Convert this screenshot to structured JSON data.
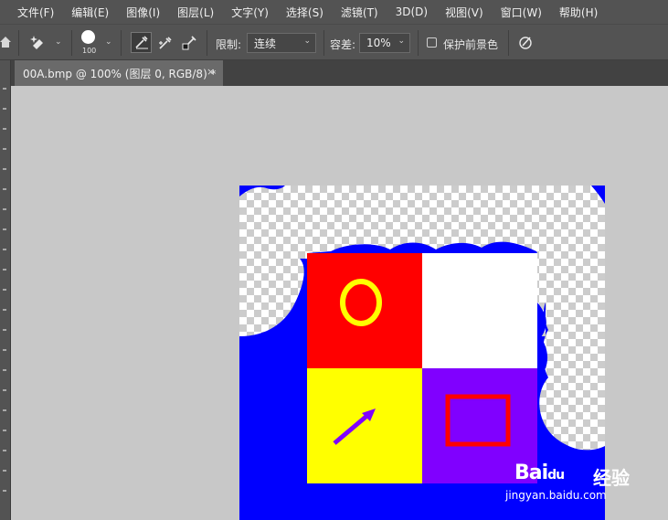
{
  "menubar": {
    "items": [
      "文件(F)",
      "编辑(E)",
      "图像(I)",
      "图层(L)",
      "文字(Y)",
      "选择(S)",
      "滤镜(T)",
      "3D(D)",
      "视图(V)",
      "窗口(W)",
      "帮助(H)"
    ]
  },
  "options": {
    "brush_size": "100",
    "limit_label": "限制:",
    "limit_value": "连续",
    "tolerance_label": "容差:",
    "tolerance_value": "10%",
    "protect_label": "保护前景色"
  },
  "document": {
    "tab_title": "00A.bmp @ 100% (图层 0, RGB/8) *",
    "close_glyph": "×"
  },
  "image": {
    "colors": {
      "red": "#ff0000",
      "white": "#ffffff",
      "yellow": "#ffff00",
      "purple": "#8000ff",
      "blue": "#0000ff"
    }
  },
  "watermark": {
    "logo": "Bai",
    "logo_paw": "du",
    "suffix": "经验",
    "url": "jingyan.baidu.com"
  }
}
